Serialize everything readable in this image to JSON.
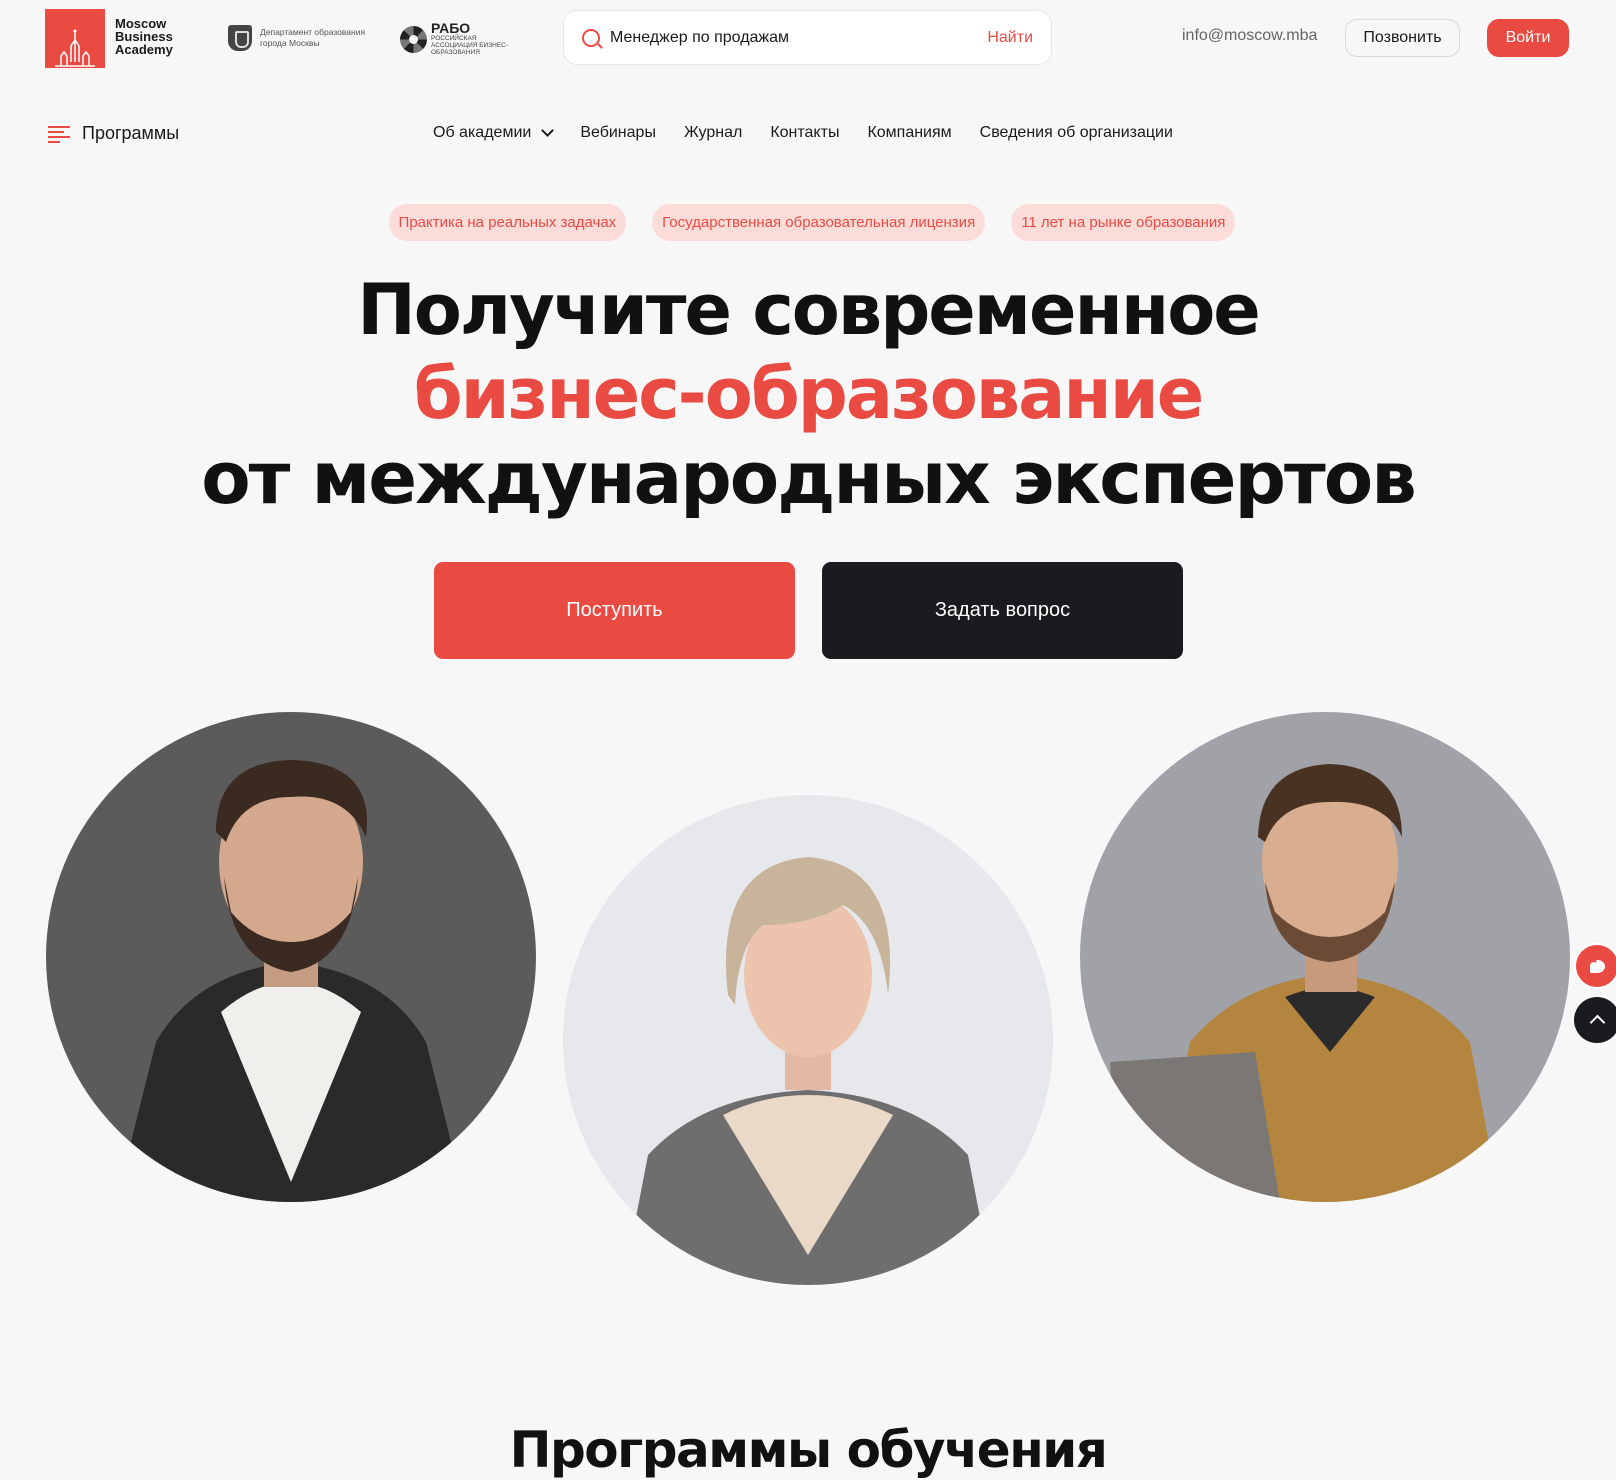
{
  "header": {
    "logo_text": "Moscow\nBusiness\nAcademy",
    "dept_text": "Департамент образования города Москвы",
    "rabo_title": "РАБО",
    "rabo_subtitle": "РОССИЙСКАЯ АССОЦИАЦИЯ БИЗНЕС-ОБРАЗОВАНИЯ",
    "search_value": "Менеджер по продажам",
    "search_button": "Найти",
    "email": "info@moscow.mba",
    "call_button": "Позвонить",
    "login_button": "Войти"
  },
  "nav": {
    "programs_label": "Программы",
    "items": [
      "Об академии",
      "Вебинары",
      "Журнал",
      "Контакты",
      "Компаниям",
      "Сведения об организации"
    ]
  },
  "badges": [
    "Практика на реальных задачах",
    "Государственная образовательная лицензия",
    "11 лет на рынке образования"
  ],
  "hero": {
    "line1": "Получите современное",
    "line2": "бизнес-образование",
    "line3": "от международных экспертов",
    "apply_button": "Поступить",
    "ask_button": "Задать вопрос"
  },
  "section": {
    "title": "Программы обучения"
  },
  "icons": {
    "search": "search-icon",
    "menu": "menu-icon",
    "chevron": "chevron-down-icon",
    "chat": "chat-icon",
    "scroll_up": "chevron-up-icon"
  },
  "colors": {
    "accent": "#e94b43",
    "dark": "#1a1b1e",
    "badge_bg": "#fbdcd9",
    "page_bg": "#f7f7f7"
  }
}
